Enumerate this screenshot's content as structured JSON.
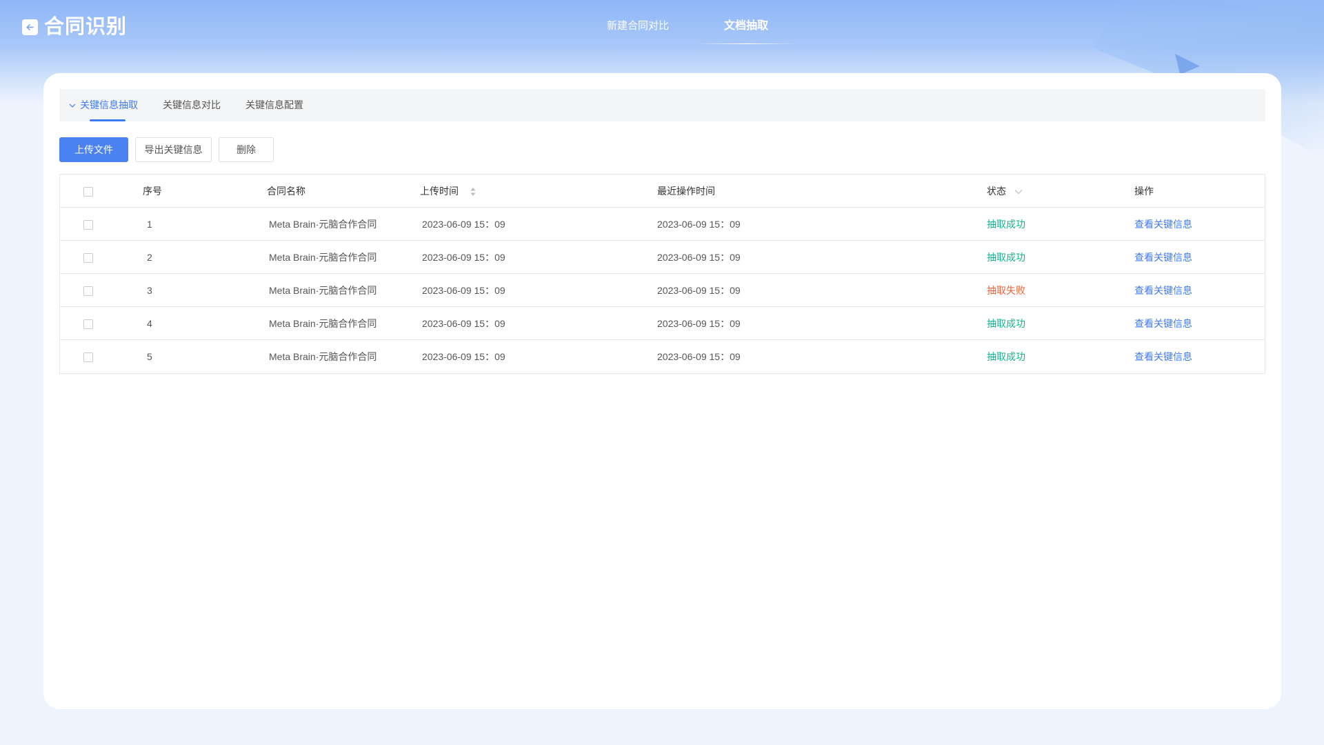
{
  "app": {
    "title": "合同识别"
  },
  "top_nav": {
    "items": [
      {
        "label": "新建合同对比"
      },
      {
        "label": "文档抽取"
      }
    ],
    "active_index": 1
  },
  "sub_tabs": [
    {
      "label": "关键信息抽取"
    },
    {
      "label": "关键信息对比"
    },
    {
      "label": "关键信息配置"
    }
  ],
  "toolbar": {
    "upload_label": "上传文件",
    "export_label": "导出关键信息",
    "delete_label": "删除"
  },
  "table": {
    "headers": {
      "index": "序号",
      "name": "合同名称",
      "upload_time": "上传时间",
      "last_op_time": "最近操作时间",
      "status": "状态",
      "action": "操作"
    },
    "rows": [
      {
        "index": "1",
        "name": "Meta Brain·元脑合作合同",
        "upload_time": "2023-06-09 15：09",
        "last_op_time": "2023-06-09 15：09",
        "status": "抽取成功",
        "status_type": "success",
        "action": "查看关键信息"
      },
      {
        "index": "2",
        "name": "Meta Brain·元脑合作合同",
        "upload_time": "2023-06-09 15：09",
        "last_op_time": "2023-06-09 15：09",
        "status": "抽取成功",
        "status_type": "success",
        "action": "查看关键信息"
      },
      {
        "index": "3",
        "name": "Meta Brain·元脑合作合同",
        "upload_time": "2023-06-09 15：09",
        "last_op_time": "2023-06-09 15：09",
        "status": "抽取失败",
        "status_type": "fail",
        "action": "查看关键信息"
      },
      {
        "index": "4",
        "name": "Meta Brain·元脑合作合同",
        "upload_time": "2023-06-09 15：09",
        "last_op_time": "2023-06-09 15：09",
        "status": "抽取成功",
        "status_type": "success",
        "action": "查看关键信息"
      },
      {
        "index": "5",
        "name": "Meta Brain·元脑合作合同",
        "upload_time": "2023-06-09 15：09",
        "last_op_time": "2023-06-09 15：09",
        "status": "抽取成功",
        "status_type": "success",
        "action": "查看关键信息"
      }
    ]
  },
  "colors": {
    "primary": "#4b82f1",
    "success": "#13b58c",
    "fail": "#f2623a",
    "link": "#3d7bf0"
  },
  "icons": {
    "back": "back-arrow-icon",
    "tab_chevron": "chevron-down-icon",
    "sort": "sort-icon",
    "filter": "filter-chevron-icon"
  }
}
